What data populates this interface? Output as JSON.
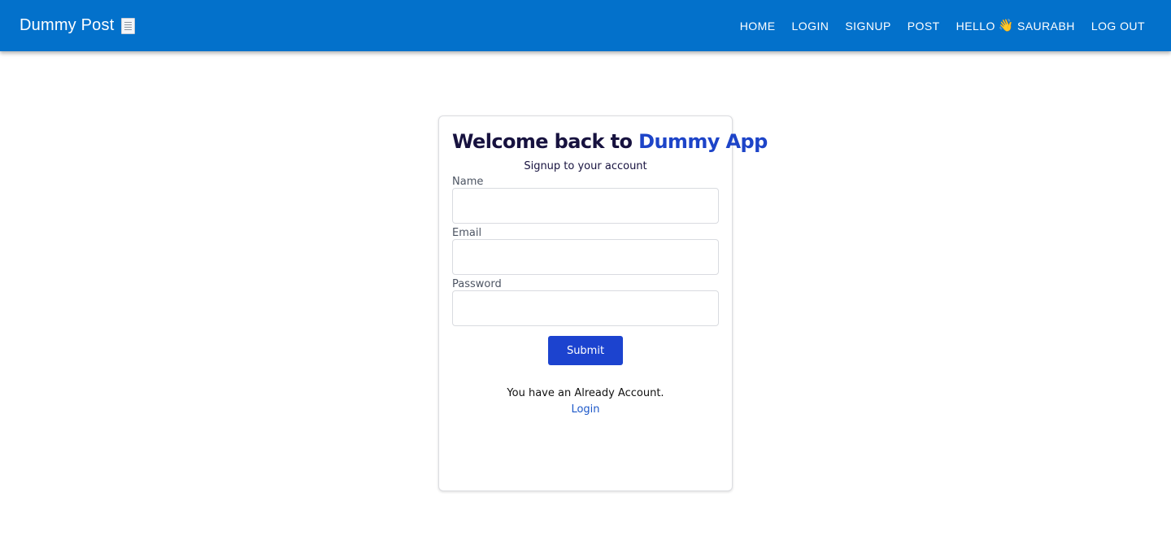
{
  "header": {
    "brand": "Dummy Post",
    "brand_icon": "document-icon",
    "nav": {
      "home": "HOME",
      "login": "LOGIN",
      "signup": "SIGNUP",
      "post": "POST",
      "hello": "HELLO",
      "user": "SAURABH",
      "wave_icon": "👋",
      "logout": "LOG OUT"
    },
    "color": "#0371cb"
  },
  "form": {
    "title_prefix": "Welcome back to",
    "title_accent": "Dummy App",
    "subtitle": "Signup to your account",
    "fields": {
      "name_label": "Name",
      "name_value": "",
      "email_label": "Email",
      "email_value": "",
      "password_label": "Password",
      "password_value": ""
    },
    "submit_label": "Submit",
    "footer_text": "You have an Already Account.",
    "login_link": "Login",
    "accent_color": "#1d44c8"
  }
}
